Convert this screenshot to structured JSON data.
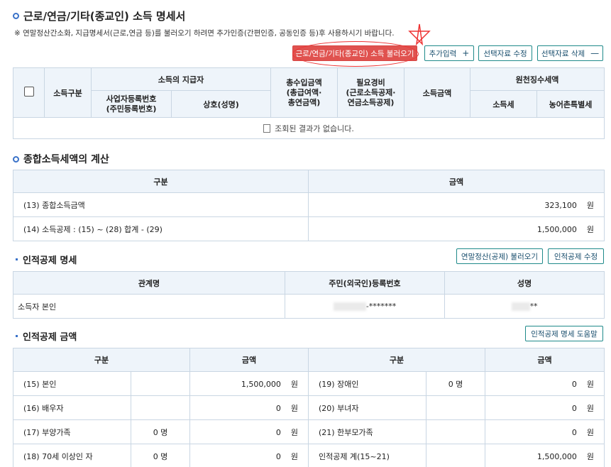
{
  "sections": {
    "income": {
      "title": "근로/연금/기타(종교인) 소득 명세서",
      "notice": "※ 연말정산간소화, 지급명세서(근로,연금 등)를 불러오기 하려면 추가인증(간편인증, 공동인증 등)후 사용하시기 바랍니다.",
      "buttons": {
        "load": "근로/연금/기타(종교인) 소득 불러오기",
        "add": "추가입력",
        "edit": "선택자료 수정",
        "delete": "선택자료 삭제"
      },
      "table": {
        "h_income_type": "소득구분",
        "h_payer": "소득의 지급자",
        "h_biz_no": "사업자등록번호\n(주민등록번호)",
        "h_name": "상호(성명)",
        "h_total": "총수입금액\n(총급여액·\n총연금액)",
        "h_expense": "필요경비\n(근로소득공제·\n연금소득공제)",
        "h_income_amt": "소득금액",
        "h_withholding": "원천징수세액",
        "h_income_tax": "소득세",
        "h_rural_tax": "농어촌특별세",
        "empty": "조회된 결과가 없습니다."
      }
    },
    "calc": {
      "title": "종합소득세액의 계산",
      "h_category": "구분",
      "h_amount": "금액",
      "rows": [
        {
          "label": "(13) 종합소득금액",
          "amount": "323,100",
          "unit": "원"
        },
        {
          "label": "(14) 소득공제 : (15) ~ (28) 합계 - (29)",
          "amount": "1,500,000",
          "unit": "원"
        }
      ]
    },
    "personal": {
      "title": "인적공제 명세",
      "buttons": {
        "load": "연말정산(공제) 불러오기",
        "edit": "인적공제 수정"
      },
      "h_relation": "관계명",
      "h_id": "주민(외국인)등록번호",
      "h_name": "성명",
      "row": {
        "relation": "소득자 본인",
        "id_suffix": "-*******",
        "name_suffix": "**"
      }
    },
    "amounts": {
      "title": "인적공제 금액",
      "help_button": "인적공제 명세 도움말",
      "h_category": "구분",
      "h_amount": "금액",
      "rows": [
        {
          "l_label": "(15) 본인",
          "l_count": "",
          "l_amount": "1,500,000",
          "r_label": "(19) 장애인",
          "r_count": "0 명",
          "r_amount": "0"
        },
        {
          "l_label": "(16) 배우자",
          "l_count": "",
          "l_amount": "0",
          "r_label": "(20) 부녀자",
          "r_count": "",
          "r_amount": "0"
        },
        {
          "l_label": "(17) 부양가족",
          "l_count": "0 명",
          "l_amount": "0",
          "r_label": "(21) 한부모가족",
          "r_count": "",
          "r_amount": "0"
        },
        {
          "l_label": "(18) 70세 이상인 자",
          "l_count": "0 명",
          "l_amount": "0",
          "r_label": "인적공제 계(15~21)",
          "r_count": "",
          "r_amount": "1,500,000"
        }
      ],
      "unit": "원"
    }
  },
  "colors": {
    "accent": "#3a72c9",
    "button_border": "#1f8a8a",
    "load_button": "#e0524f",
    "annotation": "#ee3333",
    "header_bg": "#eef4fa"
  }
}
